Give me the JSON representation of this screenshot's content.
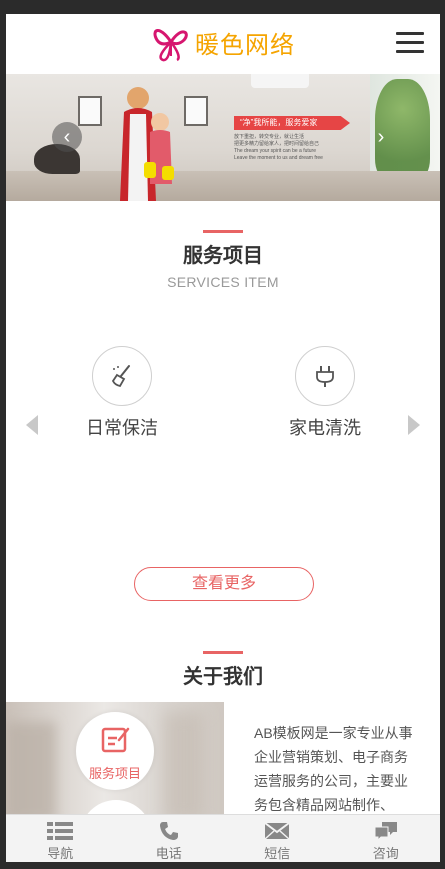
{
  "header": {
    "logo_text": "暖色网络",
    "menu_icon": "hamburger-menu-icon"
  },
  "banner": {
    "tagline": "“净”我所能，服务爱家",
    "lines": [
      "放下重担，转交专业，就让生活",
      "把更多精力留给家人，把时间留给自己",
      "The dream your spirit can be a future",
      "Leave the moment to us and dream free"
    ],
    "prev_icon": "chevron-left-icon",
    "next_icon": "chevron-right-icon"
  },
  "services": {
    "title": "服务项目",
    "subtitle": "SERVICES ITEM",
    "items": [
      {
        "label": "日常保洁",
        "icon": "broom-icon"
      },
      {
        "label": "家电清洗",
        "icon": "plug-icon"
      }
    ],
    "more_label": "查看更多",
    "accent": "#e86464"
  },
  "about": {
    "title": "关于我们",
    "circle_label": "服务项目",
    "text": "AB模板网是一家专业从事企业营销策划、电子商务运营服务的公司，主要业务包含精品网站制作、"
  },
  "footer": {
    "items": [
      {
        "label": "导航",
        "icon": "list-icon"
      },
      {
        "label": "电话",
        "icon": "phone-icon"
      },
      {
        "label": "短信",
        "icon": "envelope-icon"
      },
      {
        "label": "咨询",
        "icon": "chat-icon"
      }
    ]
  }
}
